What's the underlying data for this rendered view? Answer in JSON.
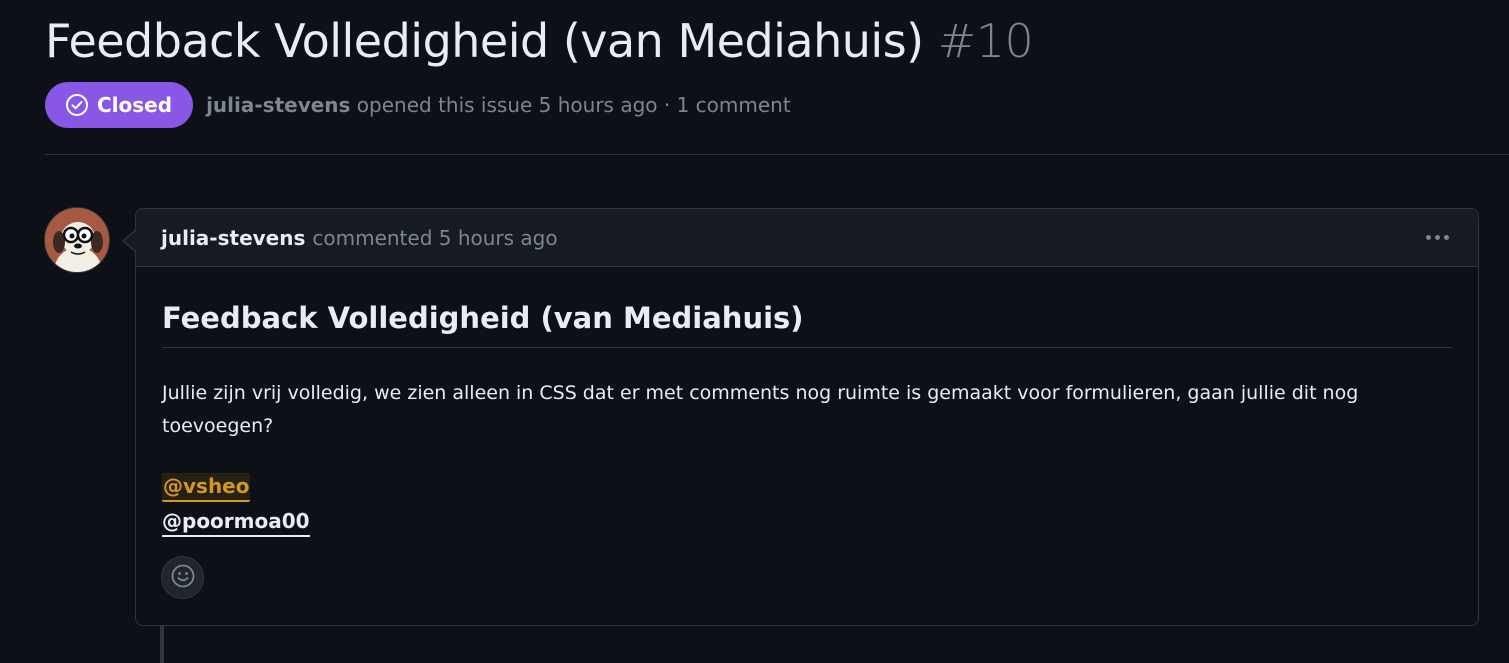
{
  "issue": {
    "title": "Feedback Volledigheid (van Mediahuis)",
    "number": "#10",
    "state": "Closed",
    "author": "julia-stevens",
    "opened_text": " opened this issue 5 hours ago · 1 comment"
  },
  "comment": {
    "author": "julia-stevens",
    "action_time": "commented 5 hours ago",
    "body_heading": "Feedback Volledigheid (van Mediahuis)",
    "body_text": "Jullie zijn vrij volledig, we zien alleen in CSS dat er met comments nog ruimte is gemaakt voor formulieren, gaan jullie dit nog toevoegen?",
    "mentions": [
      "@vsheo",
      "@poormoa00"
    ]
  },
  "icons": {
    "state": "check-circle-icon",
    "menu": "kebab-horizontal-icon",
    "reaction": "smiley-icon"
  },
  "colors": {
    "background": "#0d1117",
    "closed_badge": "#8957e5",
    "muted_text": "#7d8590",
    "border": "#30363d",
    "mention_self": "#d29922"
  }
}
